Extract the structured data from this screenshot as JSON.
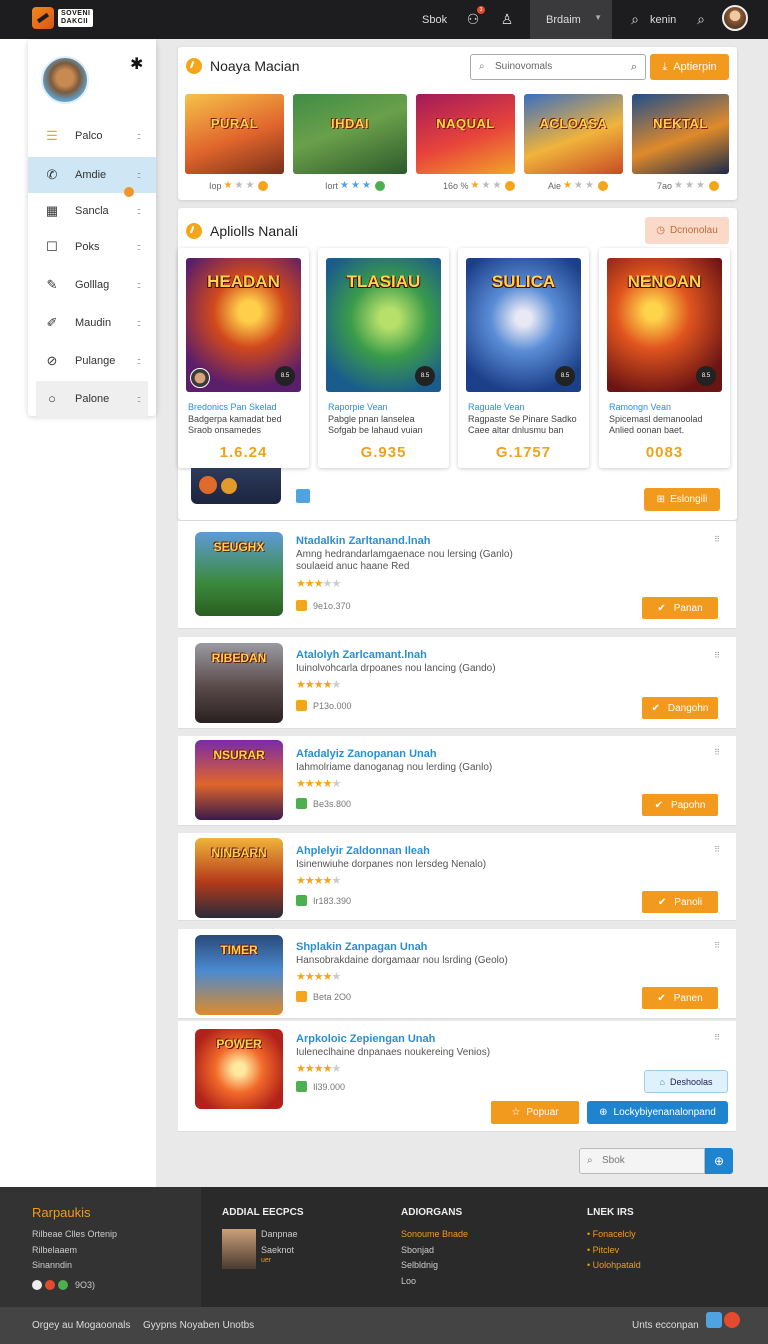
{
  "topbar": {
    "logo_line1": "SOVENI",
    "logo_line2": "DAKCII",
    "sbok": "Sbok",
    "notif_count": "3",
    "lang": "Brdaim",
    "kenin": "kenin"
  },
  "sidebar": {
    "items": [
      {
        "label": "Palco",
        "icon": "list-icon"
      },
      {
        "label": "Amdie",
        "icon": "phone-icon"
      },
      {
        "label": "Sancla",
        "icon": "table-icon"
      },
      {
        "label": "Poks",
        "icon": "square-icon"
      },
      {
        "label": "Golllag",
        "icon": "pencil-icon"
      },
      {
        "label": "Maudin",
        "icon": "edit-icon"
      },
      {
        "label": "Pulange",
        "icon": "target-icon"
      },
      {
        "label": "Palone",
        "icon": "circle-icon"
      }
    ]
  },
  "featured": {
    "title": "Noaya Macian",
    "search_placeholder": "Suinovomals",
    "button": "Aptierpin",
    "games": [
      {
        "art": "PURAL",
        "meta": "Iop"
      },
      {
        "art": "IHDAI",
        "meta": "Iort"
      },
      {
        "art": "NAQUAL",
        "meta": "16o %"
      },
      {
        "art": "ACLOASA",
        "meta": "Aie"
      },
      {
        "art": "NEKTAL",
        "meta": "7ao"
      }
    ]
  },
  "apps": {
    "title": "Apliolls Nanali",
    "button": "Dcnonolau",
    "cards": [
      {
        "art": "HEADAN",
        "title": "Bredonics Pan Skelad",
        "desc": "Badgerpa kamadat bed Sraob onsamedes",
        "price": "1.6.24"
      },
      {
        "art": "TLASIAU",
        "title": "Raporpie Vean",
        "desc": "Pabgle pnan lanselea Sofgab be lahaud vuian",
        "price": "G.935"
      },
      {
        "art": "SULICA",
        "title": "Raguale Vean",
        "desc": "Ragpaste Se Pinare Sadko Caee altar dnlusmu ban",
        "price": "G.1757"
      },
      {
        "art": "NENOAN",
        "title": "Ramongn Vean",
        "desc": "Spicemasl demanoolad Anlied oonan baet.",
        "price": "0083"
      }
    ],
    "explore_button": "Eslongili"
  },
  "list": [
    {
      "art": "SEUGHX",
      "title": "Ntadalkin Zarltanand.lnah",
      "desc": "Amng hedrandarlamgaenace nou lersing (Ganlo) soulaeid anuc haane Red",
      "rating": 3,
      "price": "9e1o.370",
      "button": "Panan"
    },
    {
      "art": "RIBEDAN",
      "title": "Atalolyh Zarlcamant.lnah",
      "desc": "Iuinolvohcarla drpoanes nou lancing (Gando)",
      "rating": 4,
      "price": "P13o.000",
      "button": "Dangohn"
    },
    {
      "art": "NSURAR",
      "title": "Afadalyiz Zanopanan Unah",
      "desc": "Iahmolriame danoganag nou lerding (Ganlo)",
      "rating": 4,
      "price": "Be3s.800",
      "button": "Papohn"
    },
    {
      "art": "NINBARN",
      "title": "Ahplelyir Zaldonnan Ileah",
      "desc": "Isinenwiuhe dorpanes non lersdeg Nenalo)",
      "rating": 4,
      "price": "Ir183.390",
      "button": "Panoli"
    },
    {
      "art": "TIMER",
      "title": "Shplakin Zanpagan Unah",
      "desc": "Hansobrakdaine dorgamaar nou lsrding (Geolo)",
      "rating": 4,
      "price": "Beta 2O0",
      "button": "Panen"
    },
    {
      "art": "POWER",
      "title": "Arpkoloic Zepiengan Unah",
      "desc": "Iuleneclhaine dnpanaes noukereing Venios)",
      "rating": 4,
      "price": "Il39.000",
      "button": ""
    }
  ],
  "bottom_buttons": {
    "details": "Deshoolas",
    "popular": "Popuar",
    "locky": "Lockybiyenanalonpand"
  },
  "bottom_search_placeholder": "Sbok",
  "footer": {
    "brand": "Rarpaukis",
    "brand_lines": [
      "Rilbeae Clles Ortenip",
      "Rilbelaaem",
      "Sinanndin",
      "9O3)"
    ],
    "col2_title": "ADDIAL EECPCS",
    "col2_lines": [
      "Danpnae",
      "Saeknot",
      "uer"
    ],
    "col3_title": "ADIORGANS",
    "col3_lines": [
      "Sonoume Bnade",
      "Sbonjad",
      "Selbldnig",
      "Loo"
    ],
    "col4_title": "LNEK IRS",
    "col4_lines": [
      "Fonacelcly",
      "Pitclev",
      "Uolohpatald"
    ],
    "bottom_left": "Orgey au Mogaoonals",
    "bottom_mid": "Gyypns Noyaben Unotbs",
    "bottom_right": "Unts  ecconpan"
  }
}
